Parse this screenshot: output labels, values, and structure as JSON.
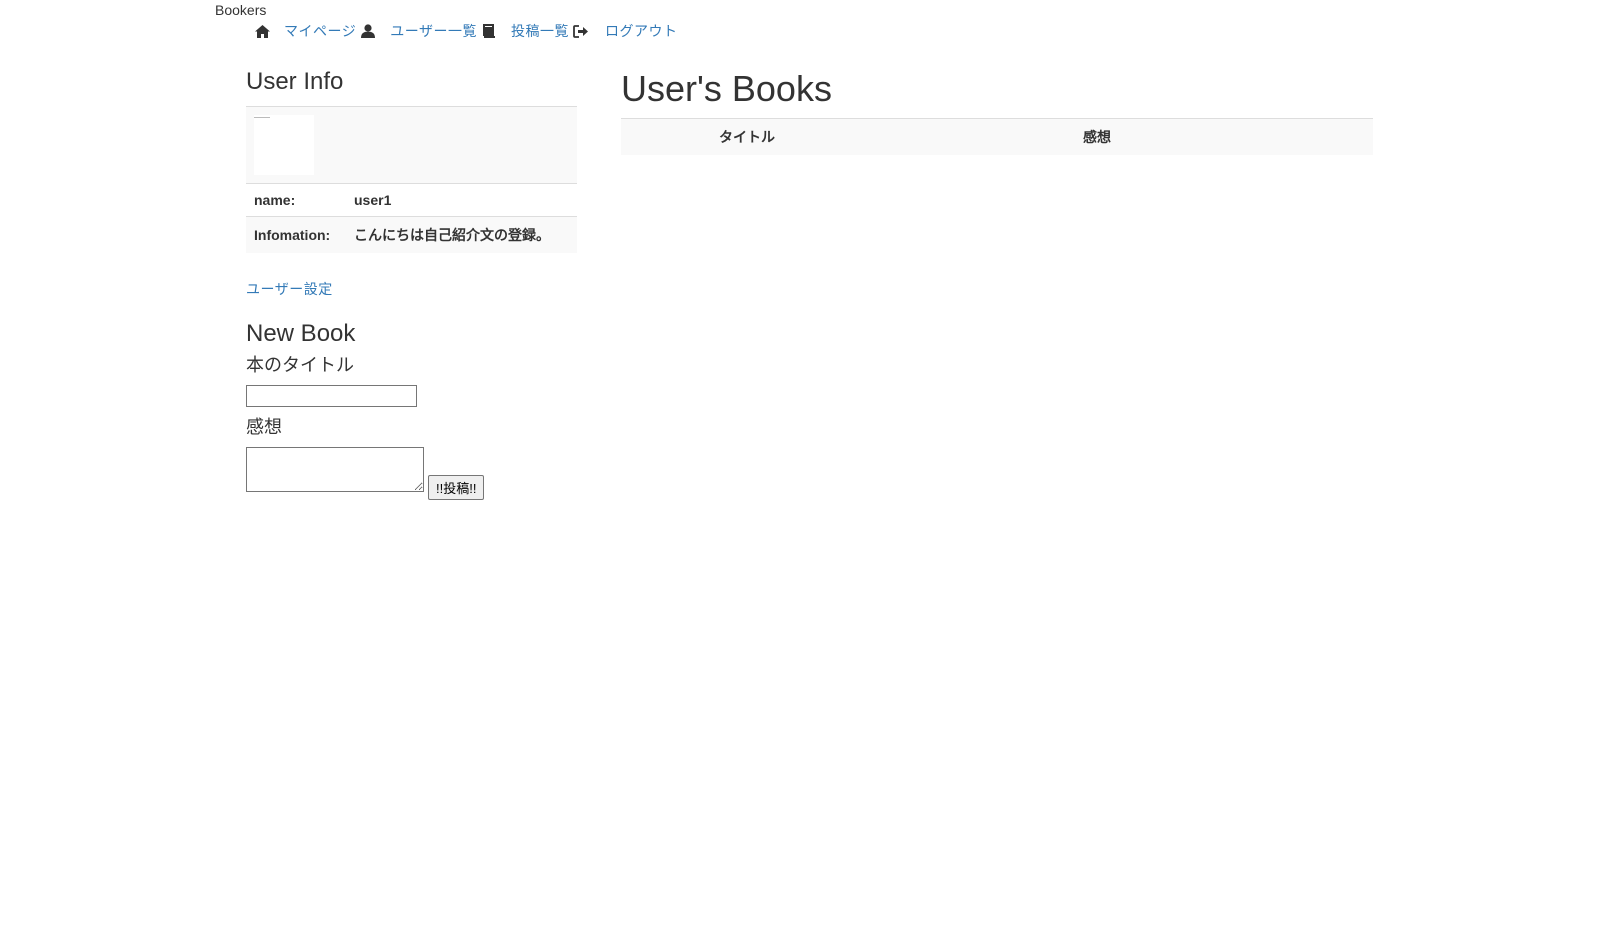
{
  "brand": "Bookers",
  "nav": {
    "home_icon": "home-icon",
    "mypage": "マイページ",
    "user_icon": "user-icon",
    "users": "ユーザー一覧",
    "book_icon": "book-icon",
    "books": "投稿一覧",
    "logout_icon": "logout-icon",
    "logout": "ログアウト"
  },
  "user_info": {
    "title": "User Info",
    "name_label": "name:",
    "name_value": "user1",
    "info_label": "Infomation:",
    "info_value": "こんにちは自己紹介文の登録。",
    "settings_link": "ユーザー設定"
  },
  "new_book": {
    "title": "New Book",
    "title_label": "本のタイトル",
    "title_value": "",
    "body_label": "感想",
    "body_value": "",
    "submit_label": "!!投稿!!"
  },
  "books": {
    "title": "User's Books",
    "columns": [
      "",
      "タイトル",
      "感想"
    ]
  }
}
